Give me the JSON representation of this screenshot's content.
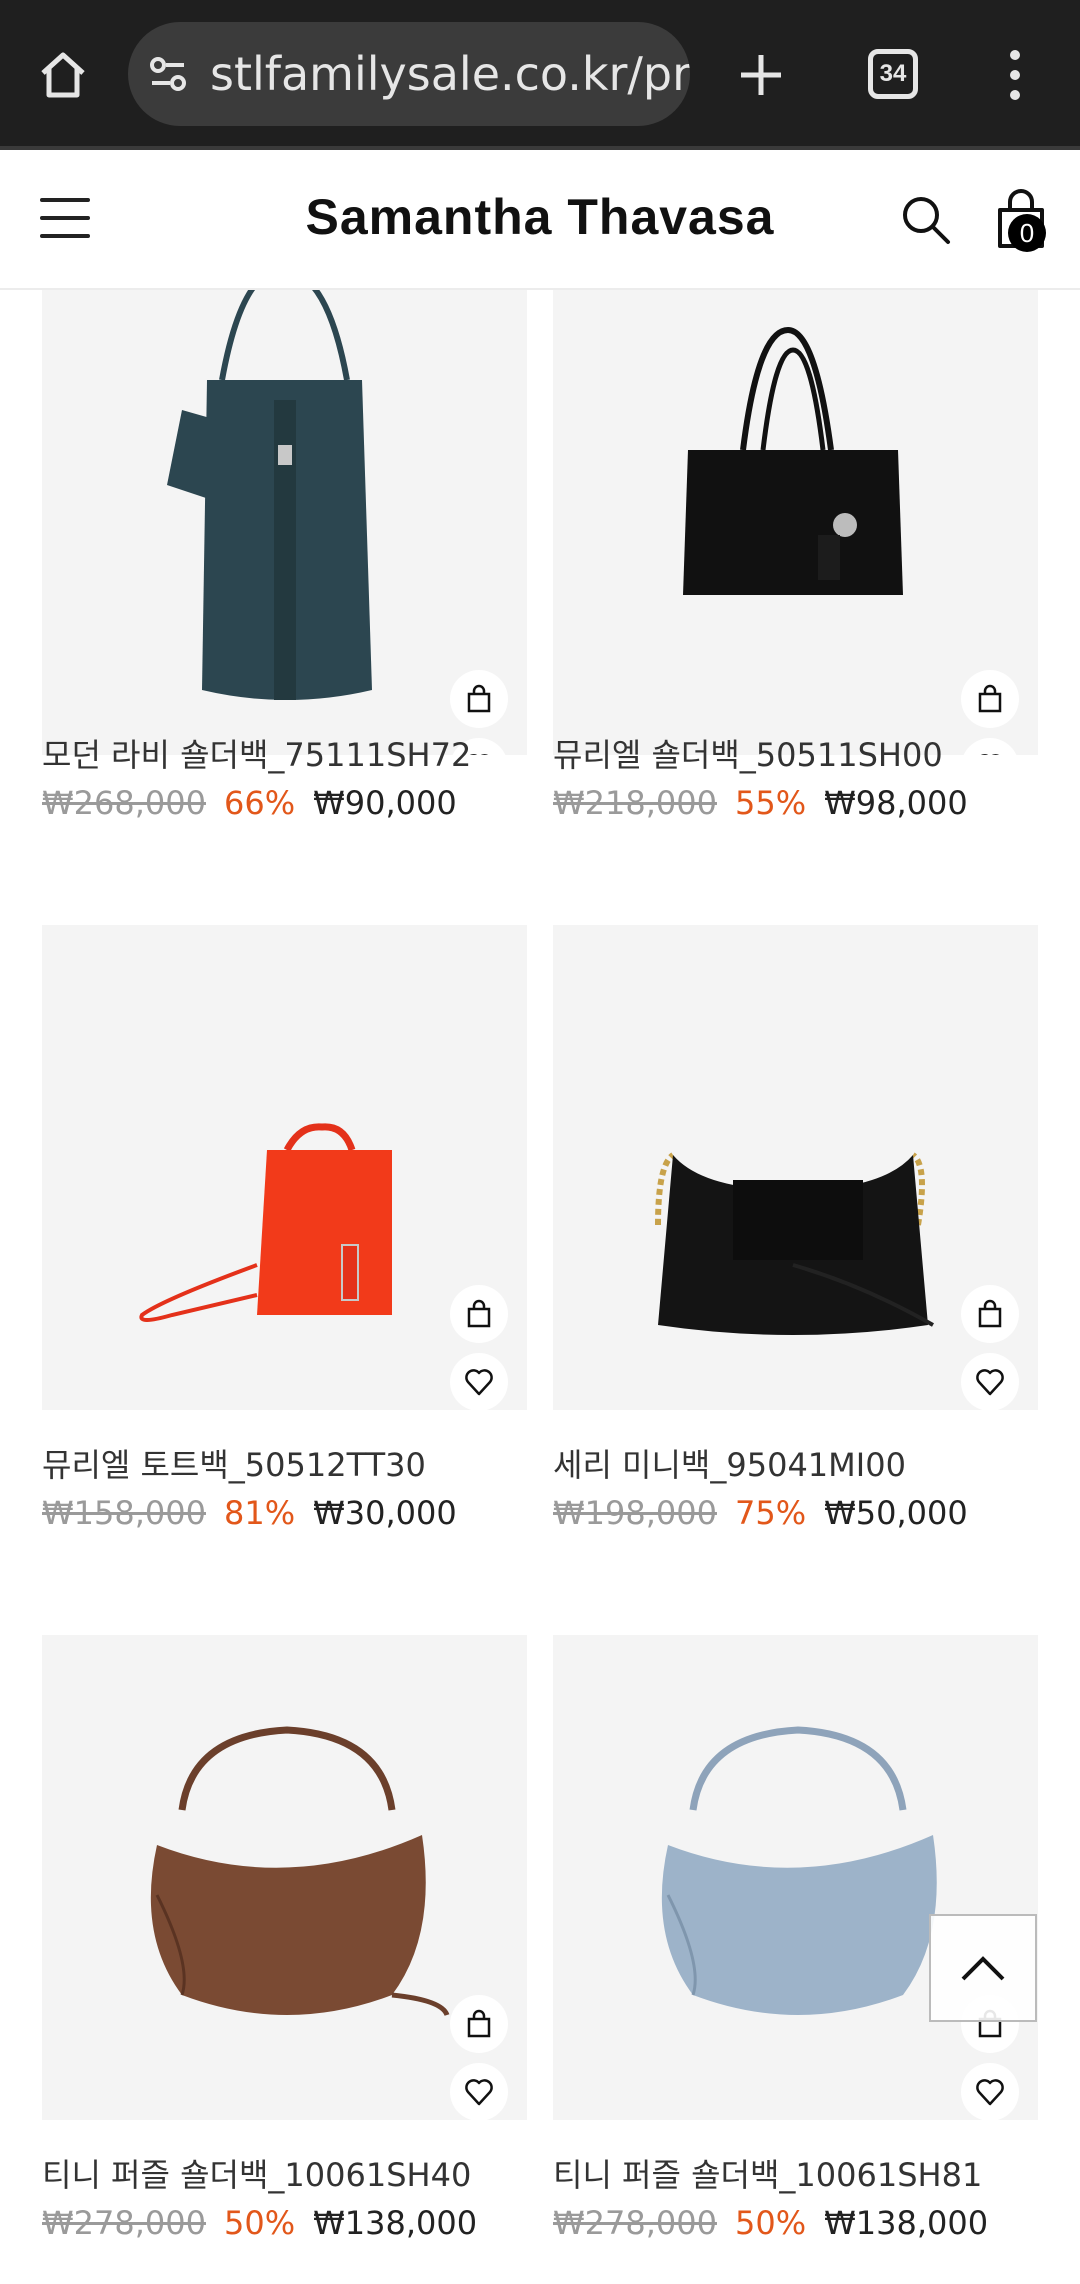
{
  "browser": {
    "url": "stlfamilysale.co.kr/pro",
    "tab_count": "34"
  },
  "site": {
    "logo": "Samantha Thavasa",
    "cart_count": "0"
  },
  "products": [
    {
      "name": "모던 라비 숄더백_75111SH72",
      "original_price": "₩268,000",
      "discount": "66%",
      "sale_price": "₩90,000",
      "color": "#2c4650"
    },
    {
      "name": "뮤리엘 숄더백_50511SH00",
      "original_price": "₩218,000",
      "discount": "55%",
      "sale_price": "₩98,000",
      "color": "#111111"
    },
    {
      "name": "뮤리엘 토트백_50512TT30",
      "original_price": "₩158,000",
      "discount": "81%",
      "sale_price": "₩30,000",
      "color": "#f23a1a"
    },
    {
      "name": "세리 미니백_95041MI00",
      "original_price": "₩198,000",
      "discount": "75%",
      "sale_price": "₩50,000",
      "color": "#141414"
    },
    {
      "name": "티니 퍼즐 숄더백_10061SH40",
      "original_price": "₩278,000",
      "discount": "50%",
      "sale_price": "₩138,000",
      "color": "#7a4a33"
    },
    {
      "name": "티니 퍼즐 숄더백_10061SH81",
      "original_price": "₩278,000",
      "discount": "50%",
      "sale_price": "₩138,000",
      "color": "#9db3c9"
    }
  ]
}
